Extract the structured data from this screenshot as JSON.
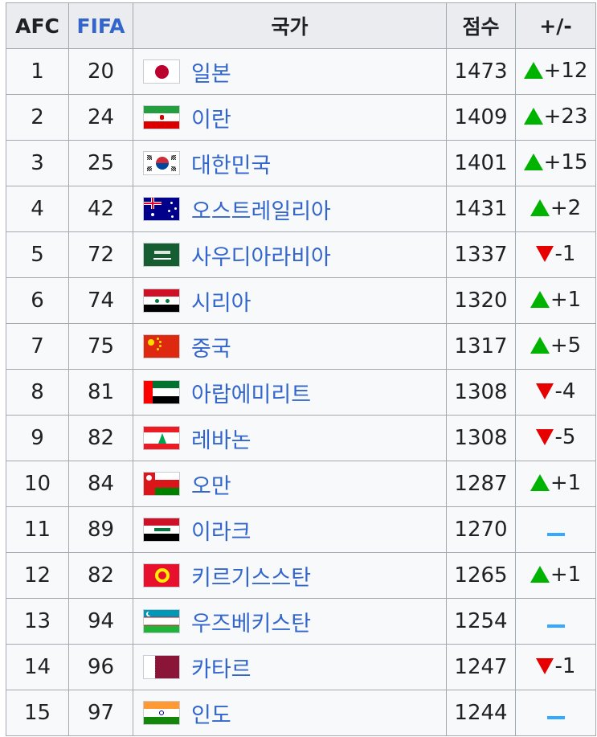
{
  "headers": {
    "afc": "AFC",
    "fifa": "FIFA",
    "country": "국가",
    "points": "점수",
    "change": "+/-"
  },
  "rows": [
    {
      "afc": "1",
      "fifa": "20",
      "country": "일본",
      "points": "1473",
      "change": "+12",
      "dir": "up",
      "flag": "japan-flag-icon"
    },
    {
      "afc": "2",
      "fifa": "24",
      "country": "이란",
      "points": "1409",
      "change": "+23",
      "dir": "up",
      "flag": "iran-flag-icon"
    },
    {
      "afc": "3",
      "fifa": "25",
      "country": "대한민국",
      "points": "1401",
      "change": "+15",
      "dir": "up",
      "flag": "south-korea-flag-icon"
    },
    {
      "afc": "4",
      "fifa": "42",
      "country": "오스트레일리아",
      "points": "1431",
      "change": "+2",
      "dir": "up",
      "flag": "australia-flag-icon"
    },
    {
      "afc": "5",
      "fifa": "72",
      "country": "사우디아라비아",
      "points": "1337",
      "change": "-1",
      "dir": "down",
      "flag": "saudi-arabia-flag-icon"
    },
    {
      "afc": "6",
      "fifa": "74",
      "country": "시리아",
      "points": "1320",
      "change": "+1",
      "dir": "up",
      "flag": "syria-flag-icon"
    },
    {
      "afc": "7",
      "fifa": "75",
      "country": "중국",
      "points": "1317",
      "change": "+5",
      "dir": "up",
      "flag": "china-flag-icon"
    },
    {
      "afc": "8",
      "fifa": "81",
      "country": "아랍에미리트",
      "points": "1308",
      "change": "-4",
      "dir": "down",
      "flag": "uae-flag-icon"
    },
    {
      "afc": "9",
      "fifa": "82",
      "country": "레바논",
      "points": "1308",
      "change": "-5",
      "dir": "down",
      "flag": "lebanon-flag-icon"
    },
    {
      "afc": "10",
      "fifa": "84",
      "country": "오만",
      "points": "1287",
      "change": "+1",
      "dir": "up",
      "flag": "oman-flag-icon"
    },
    {
      "afc": "11",
      "fifa": "89",
      "country": "이라크",
      "points": "1270",
      "change": "",
      "dir": "same",
      "flag": "iraq-flag-icon"
    },
    {
      "afc": "12",
      "fifa": "82",
      "country": "키르기스스탄",
      "points": "1265",
      "change": "+1",
      "dir": "up",
      "flag": "kyrgyzstan-flag-icon"
    },
    {
      "afc": "13",
      "fifa": "94",
      "country": "우즈베키스탄",
      "points": "1254",
      "change": "",
      "dir": "same",
      "flag": "uzbekistan-flag-icon"
    },
    {
      "afc": "14",
      "fifa": "96",
      "country": "카타르",
      "points": "1247",
      "change": "-1",
      "dir": "down",
      "flag": "qatar-flag-icon"
    },
    {
      "afc": "15",
      "fifa": "97",
      "country": "인도",
      "points": "1244",
      "change": "",
      "dir": "same",
      "flag": "india-flag-icon"
    }
  ],
  "colors": {
    "header_bg": "#eaecf0",
    "cell_bg": "#f8f9fa",
    "link": "#3366cc",
    "up": "#00b300",
    "down": "#e60000",
    "same": "#33aaff",
    "border": "#a2a9b1"
  }
}
